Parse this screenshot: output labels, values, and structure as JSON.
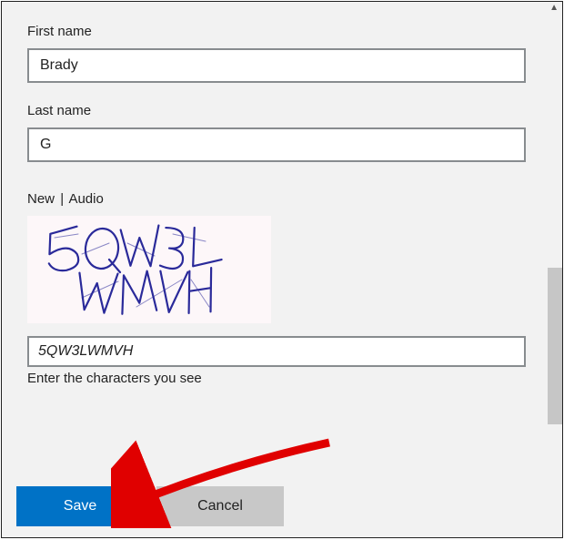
{
  "form": {
    "first_name": {
      "label": "First name",
      "value": "Brady"
    },
    "last_name": {
      "label": "Last name",
      "value": "G"
    }
  },
  "captcha": {
    "new_link": "New",
    "separator": "|",
    "audio_link": "Audio",
    "distorted_text": "5QW3LWMVH",
    "input_value": "5QW3LWMVH",
    "help_text": "Enter the characters you see"
  },
  "buttons": {
    "save": "Save",
    "cancel": "Cancel"
  }
}
